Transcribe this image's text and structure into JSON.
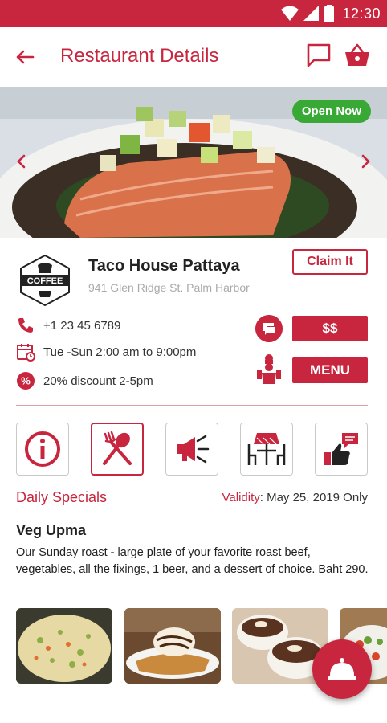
{
  "status_bar": {
    "time": "12:30",
    "icons": [
      "wifi-icon",
      "signal-icon",
      "battery-icon"
    ]
  },
  "app_bar": {
    "title": "Restaurant Details",
    "icons": [
      "back-arrow-icon",
      "chat-icon",
      "basket-icon"
    ]
  },
  "hero": {
    "badge": "Open Now"
  },
  "restaurant": {
    "logo_text": "COFFEE",
    "name": "Taco House Pattaya",
    "address": "941 Glen Ridge St. Palm Harbor",
    "claim_label": "Claim It",
    "phone": "+1 23 45 6789",
    "hours": "Tue -Sun 2:00 am to 9:00pm",
    "discount": "20% discount 2-5pm",
    "price_label": "$$",
    "menu_label": "MENU"
  },
  "tiles": [
    {
      "icon": "info-icon"
    },
    {
      "icon": "cutlery-icon",
      "active": true
    },
    {
      "icon": "megaphone-icon"
    },
    {
      "icon": "table-chairs-icon"
    },
    {
      "icon": "thumbs-up-review-icon"
    }
  ],
  "specials": {
    "label": "Daily Specials",
    "validity_label": "Validity",
    "validity_value": ": May 25, 2019 Only",
    "dish_name": "Veg Upma",
    "description": "Our Sunday roast - large plate of your favorite roast beef, vegetables, all the fixings, 1 beer, and a dessert of choice. Baht 290."
  },
  "colors": {
    "accent": "#c8253e",
    "open_badge": "#38a934"
  }
}
